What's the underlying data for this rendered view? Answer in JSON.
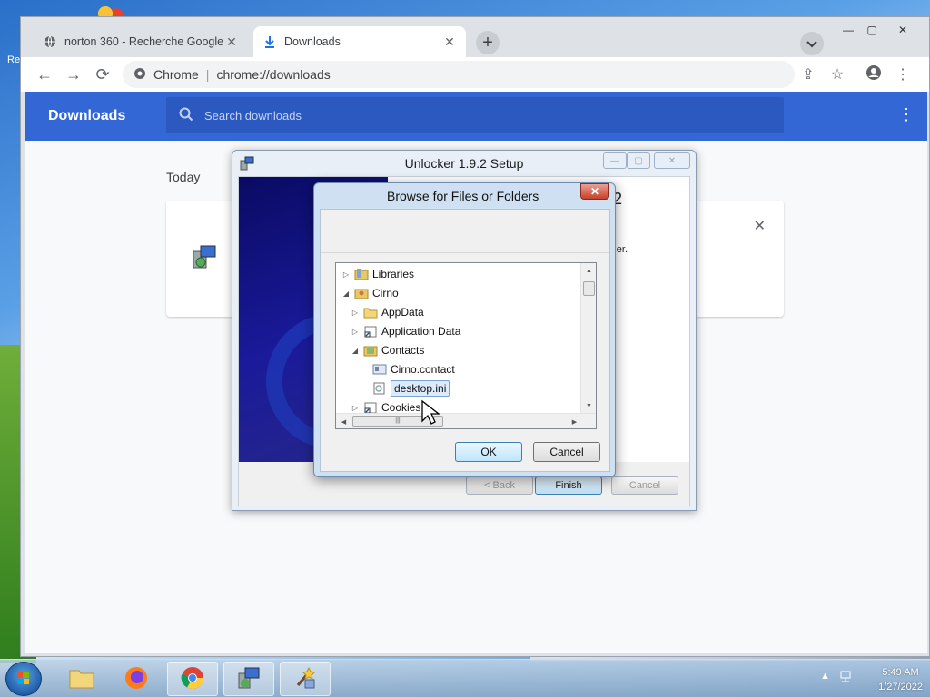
{
  "desktop": {
    "side_label": "Re"
  },
  "chrome": {
    "tabs": [
      {
        "title": "norton 360 - Recherche Google",
        "close": "✕",
        "icon": "globe-icon"
      },
      {
        "title": "Downloads",
        "close": "✕",
        "icon": "download-icon"
      }
    ],
    "new_tab": "+",
    "window_controls": {
      "minimize": "—",
      "maximize": "▢",
      "close": "✕"
    },
    "omnibox": {
      "site": "Chrome",
      "url": "chrome://downloads"
    }
  },
  "downloads_page": {
    "title": "Downloads",
    "search_placeholder": "Search downloads",
    "section_label": "Today",
    "card_close": "✕",
    "accent": "#3367d6"
  },
  "setup_dialog": {
    "title": "Unlocker 1.9.2 Setup",
    "version_fragment": "2",
    "text_fragment": "er.",
    "buttons": {
      "back": "< Back",
      "finish": "Finish",
      "cancel": "Cancel"
    }
  },
  "browse_dialog": {
    "title": "Browse for Files or Folders",
    "close": "✕",
    "tree": [
      {
        "label": "Libraries",
        "expander": "▷",
        "icon": "libraries-icon"
      },
      {
        "label": "Cirno",
        "expander": "◢",
        "icon": "user-folder-icon"
      },
      {
        "label": "AppData",
        "expander": "▷",
        "icon": "folder-icon"
      },
      {
        "label": "Application Data",
        "expander": "▷",
        "icon": "shortcut-folder-icon"
      },
      {
        "label": "Contacts",
        "expander": "◢",
        "icon": "contacts-folder-icon"
      },
      {
        "label": "Cirno.contact",
        "expander": "",
        "icon": "contact-file-icon"
      },
      {
        "label": "desktop.ini",
        "expander": "",
        "icon": "ini-file-icon",
        "selected": true
      },
      {
        "label": "Cookies",
        "expander": "▷",
        "icon": "shortcut-folder-icon"
      }
    ],
    "ok": "OK",
    "cancel": "Cancel"
  },
  "taskbar": {
    "time": "5:49 AM",
    "date": "1/27/2022",
    "tray_arrow": "▲"
  }
}
